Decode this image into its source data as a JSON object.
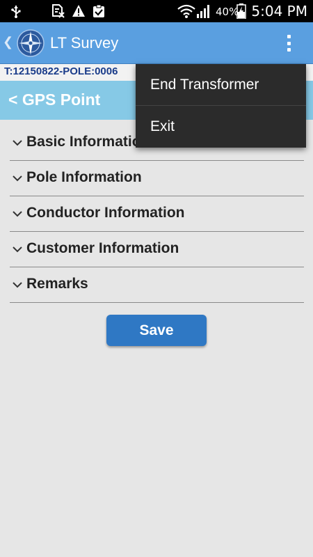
{
  "status_bar": {
    "time": "5:04 PM",
    "battery_percent": "40%",
    "icons": [
      "usb-icon",
      "sim-blocked-icon",
      "warning-icon",
      "clipboard-check-icon",
      "wifi-icon",
      "signal-icon",
      "battery-charging-icon"
    ]
  },
  "app_bar": {
    "title": "LT Survey",
    "logo": "compass-logo-icon",
    "overflow_icon": "overflow-menu-icon"
  },
  "id_bar": {
    "text": "T:12150822-POLE:0006"
  },
  "header": {
    "title": "< GPS Point"
  },
  "sections": [
    {
      "label": "Basic Information"
    },
    {
      "label": "Pole Information"
    },
    {
      "label": "Conductor Information"
    },
    {
      "label": "Customer Information"
    },
    {
      "label": "Remarks"
    }
  ],
  "save_button": {
    "label": "Save"
  },
  "menu": {
    "items": [
      {
        "label": "End Transformer"
      },
      {
        "label": "Exit"
      }
    ]
  },
  "colors": {
    "app_bar": "#5a9fe0",
    "header": "#86c9e6",
    "id_text": "#1a3c8a",
    "save_button": "#2f78c4",
    "menu_bg": "#2b2b2b",
    "background": "#e6e6e6"
  }
}
